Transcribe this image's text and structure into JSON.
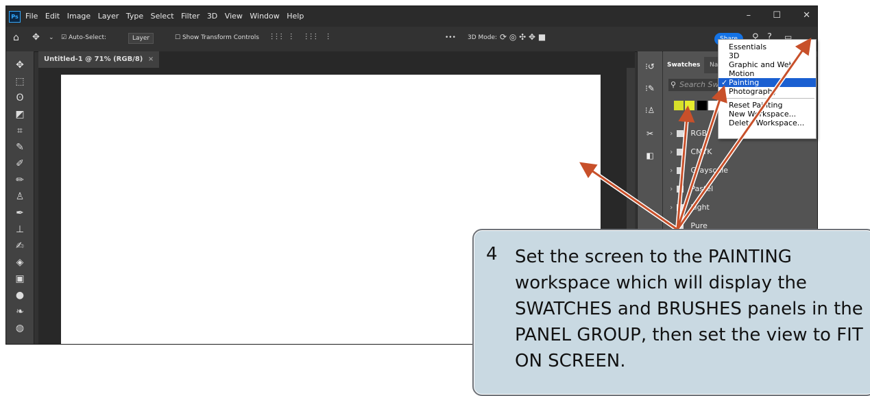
{
  "app": {
    "logo": "Ps",
    "menus": [
      "File",
      "Edit",
      "Image",
      "Layer",
      "Type",
      "Select",
      "Filter",
      "3D",
      "View",
      "Window",
      "Help"
    ],
    "window_controls": [
      "–",
      "☐",
      "✕"
    ]
  },
  "options": {
    "auto_select_label": "Auto-Select:",
    "layer_dropdown": "Layer",
    "show_transform": "Show Transform Controls",
    "more": "•••",
    "mode_3d": "3D Mode:",
    "share": "Share"
  },
  "document": {
    "tab_title": "Untitled-1 @ 71% (RGB/8)",
    "tab_close": "×"
  },
  "panel": {
    "tab_swatches": "Swatches",
    "tab_nav": "Nav",
    "search_placeholder": "Search Sw",
    "swatch_colors": [
      "#d7e02a",
      "#e6ec2e",
      "#000000",
      "#ffffff"
    ],
    "folders": [
      "RGB",
      "CMYK",
      "Grayscale",
      "Pastel",
      "Light",
      "Pure"
    ]
  },
  "workspace_menu": {
    "items": [
      "Essentials",
      "3D",
      "Graphic and Web",
      "Motion",
      "Painting",
      "Photography"
    ],
    "selected": "Painting",
    "actions": [
      "Reset Painting",
      "New Workspace...",
      "Delete Workspace..."
    ]
  },
  "callout": {
    "number": "4",
    "text": "Set the screen to the PAINTING workspace which will display the SWATCHES and BRUSHES panels in the PANEL GROUP, then set the view to FIT ON SCREEN."
  },
  "colors": {
    "arrow": "#c8502a",
    "accent": "#1473e6",
    "menu_highlight": "#1a5fd1"
  }
}
